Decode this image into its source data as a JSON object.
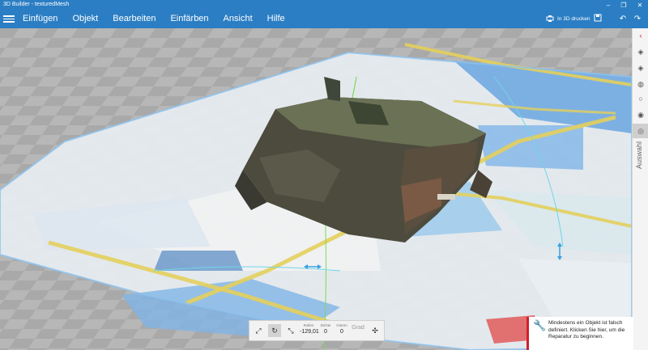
{
  "window": {
    "title": "3D Builder - texturedMesh"
  },
  "menu": [
    "Einfügen",
    "Objekt",
    "Bearbeiten",
    "Einfärben",
    "Ansicht",
    "Hilfe"
  ],
  "header": {
    "print_label": "In 3D drucken"
  },
  "right_panel": {
    "label": "Auswahl"
  },
  "transform_toolbar": {
    "fields": [
      {
        "label": "Rollen",
        "value": "-129,01"
      },
      {
        "label": "Dichte",
        "value": "0"
      },
      {
        "label": "Gieren",
        "value": "0"
      }
    ],
    "unit": "Grad"
  },
  "notification": {
    "message": "Mindestens ein Objekt ist falsch definiert. Klicken Sie hier, um die Reparatur zu beginnen."
  },
  "colors": {
    "accent": "#2b7ec3",
    "error": "#d21f2b"
  }
}
